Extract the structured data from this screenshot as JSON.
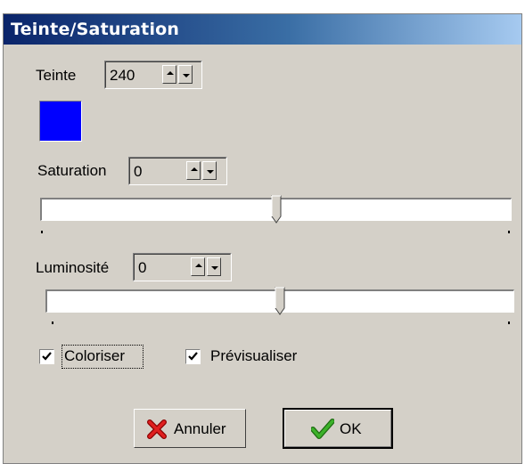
{
  "window": {
    "title": "Teinte/Saturation"
  },
  "hue": {
    "label": "Teinte",
    "value": "240",
    "swatch_color": "#0000ff"
  },
  "saturation": {
    "label": "Saturation",
    "value": "0",
    "slider_level": 0.5
  },
  "luminosity": {
    "label": "Luminosité",
    "value": "0",
    "slider_level": 0.5
  },
  "options": {
    "colorize": {
      "label": "Coloriser",
      "checked": true
    },
    "preview": {
      "label": "Prévisualiser",
      "checked": true
    }
  },
  "buttons": {
    "cancel": {
      "label": "Annuler",
      "icon": "red-x-icon"
    },
    "ok": {
      "label": "OK",
      "icon": "green-check-icon"
    }
  },
  "colors": {
    "titlebar_start": "#0a246a",
    "titlebar_end": "#a6caf0",
    "face": "#d4d0c8"
  }
}
